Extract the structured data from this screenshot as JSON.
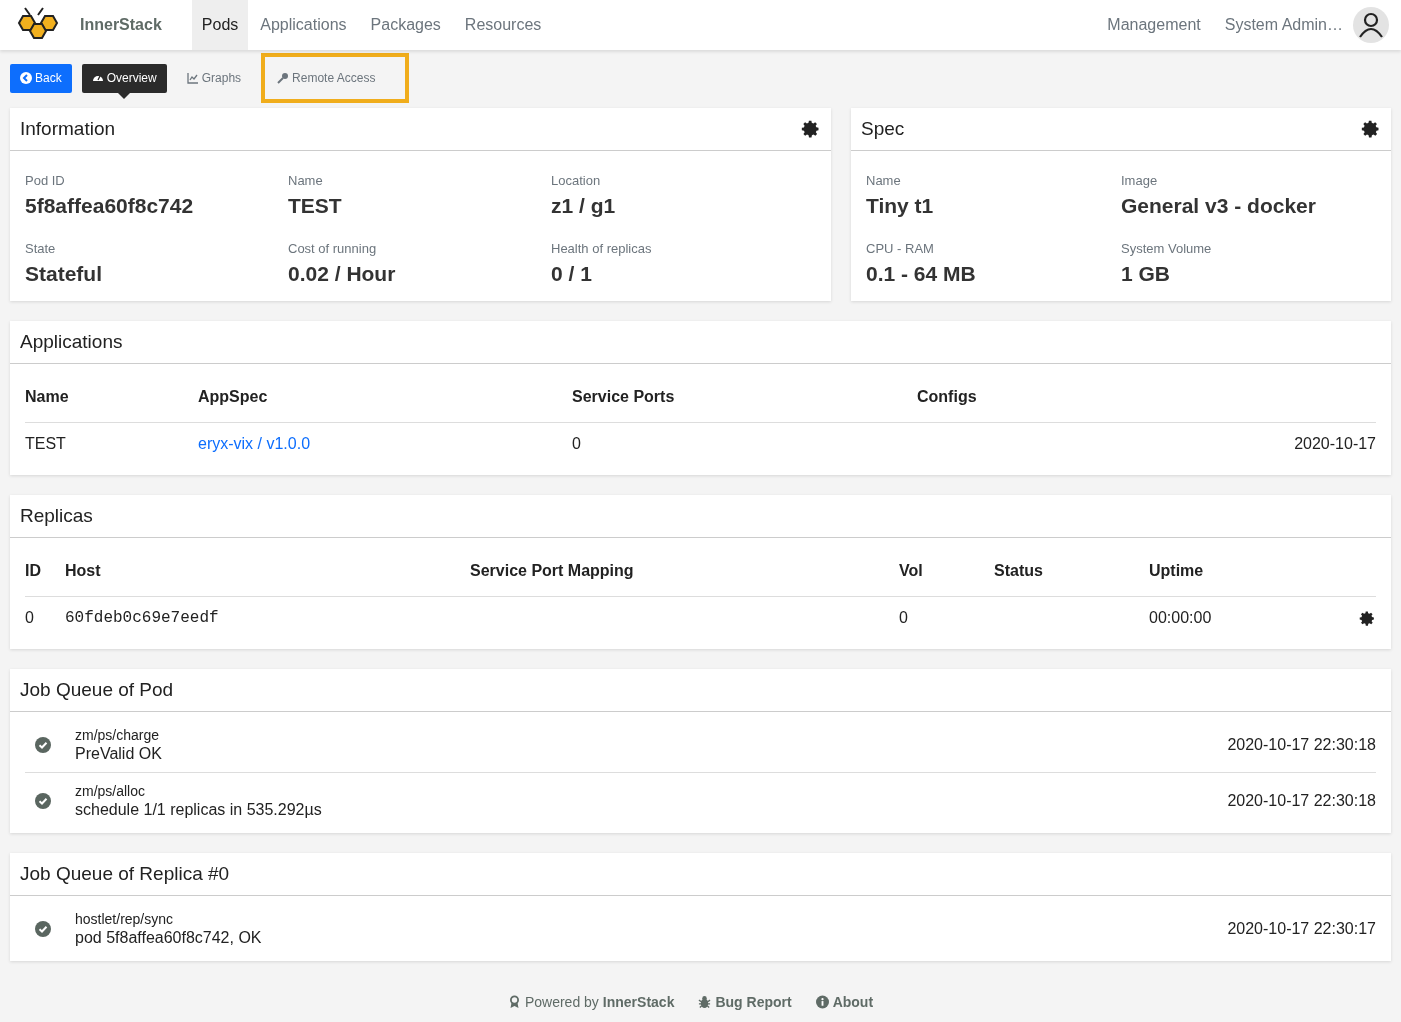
{
  "navbar": {
    "brand": "InnerStack",
    "items": [
      {
        "label": "Pods",
        "selected": true
      },
      {
        "label": "Applications",
        "selected": false
      },
      {
        "label": "Packages",
        "selected": false
      },
      {
        "label": "Resources",
        "selected": false
      }
    ],
    "right_items": [
      "Management"
    ],
    "user": "System Admin…"
  },
  "subnav": {
    "back": "Back",
    "tabs": [
      {
        "label": "Overview",
        "selected": true,
        "highlighted": false
      },
      {
        "label": "Graphs",
        "selected": false,
        "highlighted": false
      },
      {
        "label": "Remote Access",
        "selected": false,
        "highlighted": true
      }
    ]
  },
  "information": {
    "title": "Information",
    "fields": [
      {
        "label": "Pod ID",
        "value": "5f8affea60f8c742"
      },
      {
        "label": "Name",
        "value": "TEST"
      },
      {
        "label": "Location",
        "value": "z1 / g1"
      },
      {
        "label": "State",
        "value": "Stateful"
      },
      {
        "label": "Cost of running",
        "value": "0.02 / Hour"
      },
      {
        "label": "Health of replicas",
        "value": "0 / 1"
      }
    ]
  },
  "spec": {
    "title": "Spec",
    "fields": [
      {
        "label": "Name",
        "value": "Tiny t1"
      },
      {
        "label": "Image",
        "value": "General v3 - docker"
      },
      {
        "label": "CPU - RAM",
        "value": "0.1 - 64 MB"
      },
      {
        "label": "System Volume",
        "value": "1 GB"
      }
    ]
  },
  "applications": {
    "title": "Applications",
    "columns": [
      "Name",
      "AppSpec",
      "Service Ports",
      "Configs"
    ],
    "rows": [
      {
        "name": "TEST",
        "appspec": "eryx-vix / v1.0.0",
        "service_ports": "0",
        "column_5": "2020-10-17"
      }
    ]
  },
  "replicas": {
    "title": "Replicas",
    "columns": [
      "ID",
      "Host",
      "Service Port Mapping",
      "Vol",
      "Status",
      "Uptime"
    ],
    "rows": [
      {
        "id": "0",
        "host": "60fdeb0c69e7eedf",
        "vol": "0",
        "uptime": "00:00:00"
      }
    ]
  },
  "job_queues": [
    {
      "title": "Job Queue of Pod",
      "jobs": [
        {
          "name": "zm/ps/charge",
          "message": "PreValid OK",
          "time": "2020-10-17 22:30:18"
        },
        {
          "name": "zm/ps/alloc",
          "message": "schedule 1/1 replicas in 535.292µs",
          "time": "2020-10-17 22:30:18"
        }
      ]
    },
    {
      "title": "Job Queue of Replica #0",
      "jobs": [
        {
          "name": "hostlet/rep/sync",
          "message": "pod 5f8affea60f8c742, OK",
          "time": "2020-10-17 22:30:17"
        }
      ]
    }
  ],
  "footer": {
    "powered_by": "Powered by **InnerStack**",
    "links": [
      {
        "label": "Bug Report"
      },
      {
        "label": "About"
      }
    ]
  }
}
